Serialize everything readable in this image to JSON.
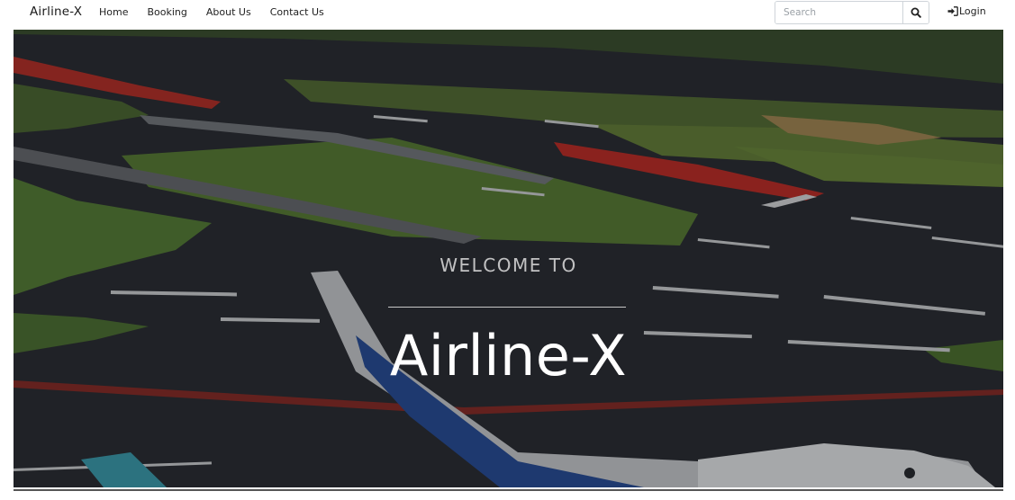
{
  "nav": {
    "brand": "Airline-X",
    "links": [
      "Home",
      "Booking",
      "About Us",
      "Contact Us"
    ],
    "search_placeholder": "Search",
    "login_label": "Login"
  },
  "hero": {
    "kicker": "WELCOME TO",
    "title": "Airline-X"
  },
  "icons": {
    "search": "search-icon",
    "login": "sign-in-icon"
  },
  "colors": {
    "hero_overlay": "#2b2e34",
    "runway_red": "#c0302a",
    "grass_green": "#5f8a3a",
    "plane_blue": "#2a4f9a"
  }
}
